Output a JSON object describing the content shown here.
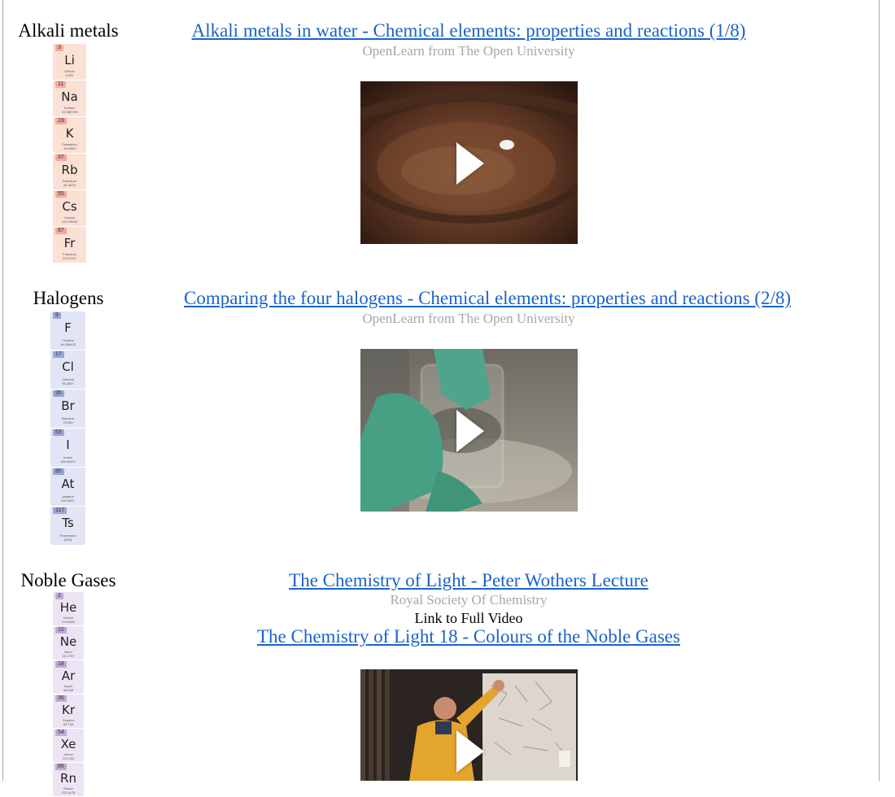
{
  "sections": [
    {
      "title": "Alkali metals",
      "video_title": "Alkali metals in water - Chemical elements: properties and reactions (1/8)",
      "source": "OpenLearn from The Open University",
      "colors": {
        "tile_bg": "#fbe0d6",
        "num_bg": "#f4a99a"
      },
      "elements": [
        {
          "num": "3",
          "sym": "Li",
          "name": "Lithium",
          "mass": "6.941"
        },
        {
          "num": "11",
          "sym": "Na",
          "name": "Sodium",
          "mass": "22.989769"
        },
        {
          "num": "19",
          "sym": "K",
          "name": "Potassium",
          "mass": "39.0983"
        },
        {
          "num": "37",
          "sym": "Rb",
          "name": "Rubidium",
          "mass": "85.4678"
        },
        {
          "num": "55",
          "sym": "Cs",
          "name": "Cesium",
          "mass": "132.90545"
        },
        {
          "num": "87",
          "sym": "Fr",
          "name": "Francium",
          "mass": "223.0197"
        }
      ]
    },
    {
      "title": "Halogens",
      "video_title": "Comparing the four halogens - Chemical elements: properties and reactions (2/8)",
      "source": "OpenLearn from The Open University",
      "colors": {
        "tile_bg": "#e1e5f5",
        "num_bg": "#9aa6d6"
      },
      "elements": [
        {
          "num": "9",
          "sym": "F",
          "name": "Fluorine",
          "mass": "18.998403"
        },
        {
          "num": "17",
          "sym": "Cl",
          "name": "Chlorine",
          "mass": "35.4527"
        },
        {
          "num": "35",
          "sym": "Br",
          "name": "Bromine",
          "mass": "79.904"
        },
        {
          "num": "53",
          "sym": "I",
          "name": "Iodine",
          "mass": "126.90447"
        },
        {
          "num": "85",
          "sym": "At",
          "name": "Astatine",
          "mass": "209.9871"
        },
        {
          "num": "117",
          "sym": "Ts",
          "name": "Tennessine",
          "mass": "[294]"
        }
      ]
    },
    {
      "title": "Noble Gases",
      "video_title": "The Chemistry of Light - Peter Wothers Lecture",
      "source": "Royal Society Of Chemistry",
      "extra_text": "Link to Full Video",
      "sub_video_title": "The Chemistry of Light 18 - Colours of the Noble Gases",
      "colors": {
        "tile_bg": "#ede4f3",
        "num_bg": "#c2a9d8"
      },
      "elements": [
        {
          "num": "2",
          "sym": "He",
          "name": "Helium",
          "mass": "4.002602"
        },
        {
          "num": "10",
          "sym": "Ne",
          "name": "Neon",
          "mass": "20.1797"
        },
        {
          "num": "18",
          "sym": "Ar",
          "name": "Argon",
          "mass": "39.948"
        },
        {
          "num": "36",
          "sym": "Kr",
          "name": "Krypton",
          "mass": "83.798"
        },
        {
          "num": "54",
          "sym": "Xe",
          "name": "Xenon",
          "mass": "131.293"
        },
        {
          "num": "86",
          "sym": "Rn",
          "name": "Radon",
          "mass": "222.0176"
        }
      ]
    }
  ]
}
